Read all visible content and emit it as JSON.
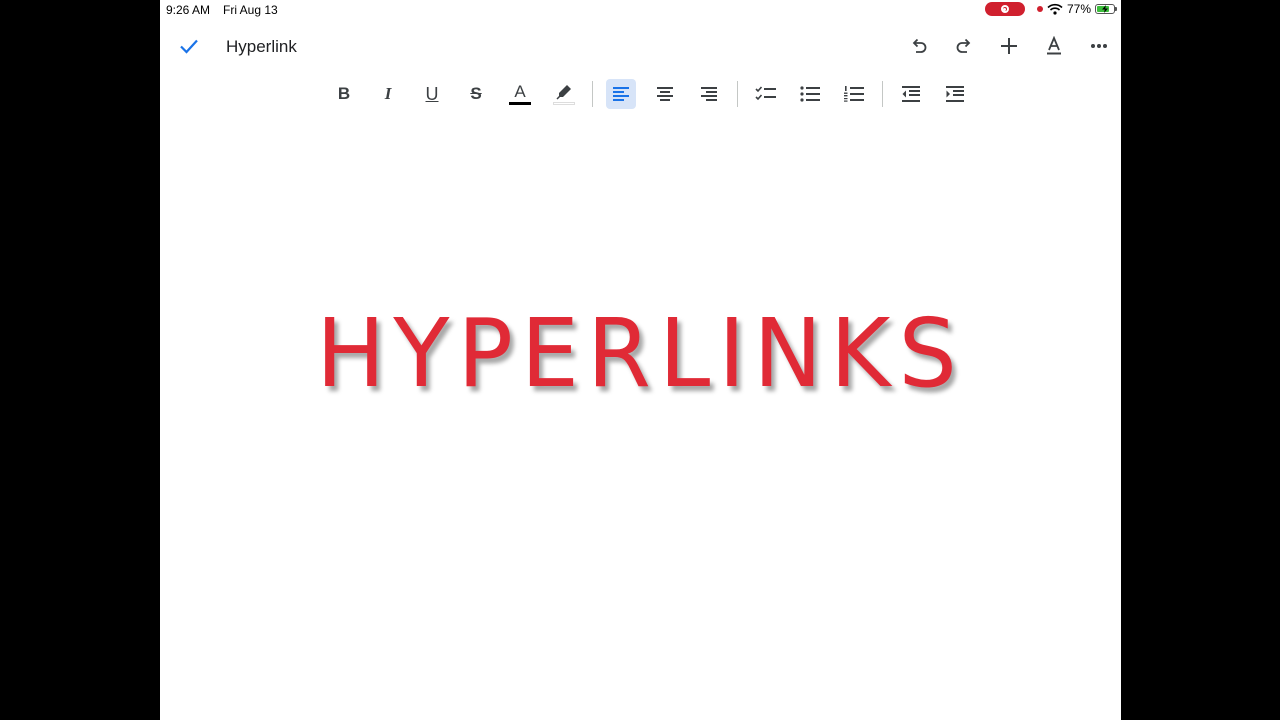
{
  "status_bar": {
    "time": "9:26 AM",
    "date": "Fri Aug 13",
    "battery_percent": "77%",
    "battery_level": 0.77,
    "recording_color": "#d0202e"
  },
  "app_bar": {
    "title": "Hyperlink",
    "actions": [
      "undo-icon",
      "redo-icon",
      "plus-icon",
      "text-format-icon",
      "more-icon"
    ]
  },
  "toolbar": {
    "active_alignment": "left",
    "items": [
      "bold",
      "italic",
      "underline",
      "strikethrough",
      "text-color",
      "highlight",
      "align-left",
      "align-center",
      "align-right",
      "checklist",
      "bulleted-list",
      "numbered-list",
      "decrease-indent",
      "increase-indent"
    ],
    "bold_glyph": "B",
    "italic_glyph": "I",
    "underline_glyph": "U",
    "strike_glyph": "S",
    "textcolor_glyph": "A",
    "accent_color": "#1a73e8"
  },
  "document": {
    "headline": "HYPERLINKS",
    "headline_color": "#e02a36"
  }
}
